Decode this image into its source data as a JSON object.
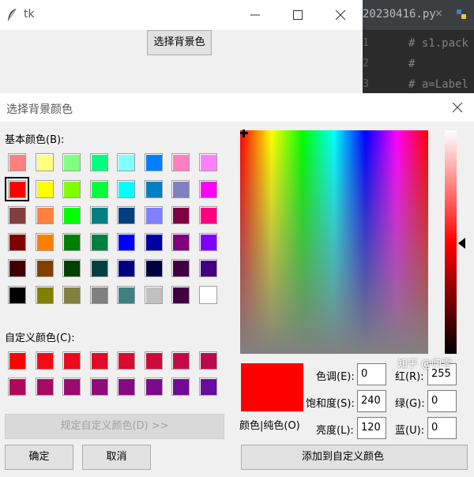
{
  "tk_window": {
    "title": "tk",
    "button_label": "选择背景色",
    "minimize_icon": "minimize-icon",
    "maximize_icon": "maximize-icon",
    "close_icon": "close-icon"
  },
  "editor": {
    "tab_label": "20230416.py",
    "tab_close": "×",
    "gutter": [
      "1",
      "2",
      "3"
    ],
    "lines": [
      "# s1.pack",
      "#",
      "# a=Label"
    ]
  },
  "dialog": {
    "title": "选择背景颜色",
    "basic_colors_label": "基本颜色(B):",
    "custom_colors_label": "自定义颜色(C):",
    "define_custom_button": "规定自定义颜色(D) >>",
    "ok_button": "确定",
    "cancel_button": "取消",
    "add_custom_button": "添加到自定义颜色",
    "color_solid_label": "颜色|纯色(O)",
    "hue_label": "色调(E):",
    "sat_label": "饱和度(S):",
    "lum_label": "亮度(L):",
    "red_label": "红(R):",
    "green_label": "绿(G):",
    "blue_label": "蓝(U):",
    "hue_value": "0",
    "sat_value": "240",
    "lum_value": "120",
    "red_value": "255",
    "green_value": "0",
    "blue_value": "0",
    "preview_color": "#ff0000",
    "basic_colors": [
      [
        "#ff8080",
        "#ffff80",
        "#80ff80",
        "#00ff80",
        "#80ffff",
        "#0080ff",
        "#ff80c0",
        "#ff80ff"
      ],
      [
        "#ff0000",
        "#ffff00",
        "#80ff00",
        "#00ff40",
        "#00ffff",
        "#0080c0",
        "#8080c0",
        "#ff00ff"
      ],
      [
        "#804040",
        "#ff8040",
        "#00ff00",
        "#008080",
        "#004080",
        "#8080ff",
        "#800040",
        "#ff0080"
      ],
      [
        "#800000",
        "#ff8000",
        "#008000",
        "#008040",
        "#0000ff",
        "#0000a0",
        "#800080",
        "#8000ff"
      ],
      [
        "#400000",
        "#804000",
        "#004000",
        "#004040",
        "#000080",
        "#000040",
        "#400040",
        "#400080"
      ],
      [
        "#000000",
        "#808000",
        "#808040",
        "#808080",
        "#408080",
        "#c0c0c0",
        "#400040",
        "#ffffff"
      ]
    ],
    "custom_colors": [
      [
        "#ff0000",
        "#f50a14",
        "#eb0a1e",
        "#e10a28",
        "#d70a32",
        "#cd0a3c",
        "#c30a46",
        "#b90a50"
      ],
      [
        "#af0a5a",
        "#a50a64",
        "#9b0a6e",
        "#910a78",
        "#870a82",
        "#7d0a8c",
        "#730a96",
        "#690aa0"
      ]
    ],
    "selected_basic": "#ff0000"
  },
  "watermark": "知乎 @归零"
}
